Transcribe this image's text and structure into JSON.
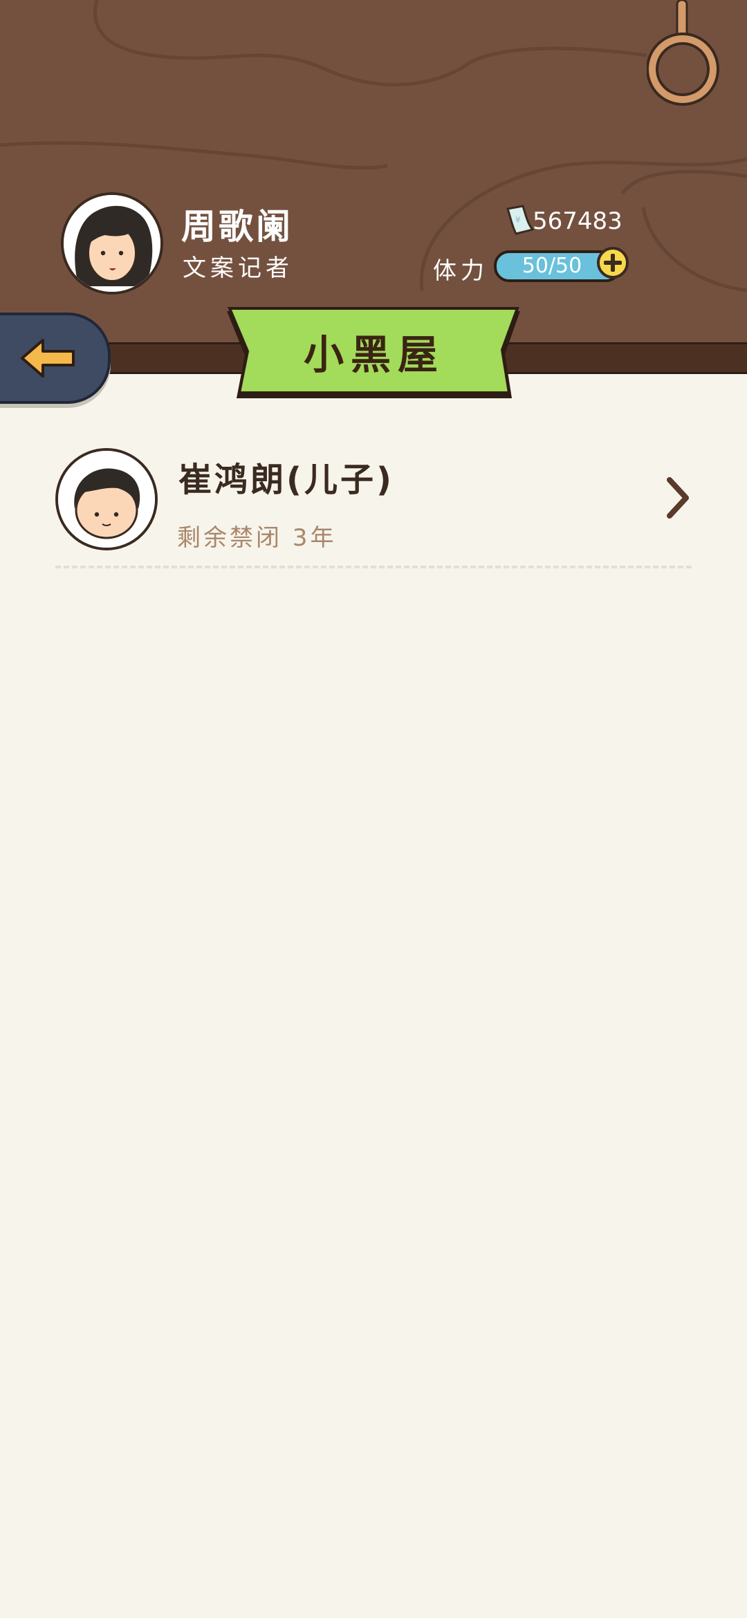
{
  "player": {
    "name": "周歌阑",
    "title": "文案记者",
    "money": "567483",
    "stamina_label": "体力",
    "stamina_value": "50/50"
  },
  "page": {
    "title": "小黑屋"
  },
  "list": [
    {
      "name": "崔鸿朗(儿子)",
      "status": "剩余禁闭 3年"
    }
  ],
  "icons": {
    "back": "arrow-left-icon",
    "money": "banknote-icon",
    "add": "plus-icon",
    "more": "chevron-right-icon",
    "rope": "rope-ring-icon"
  },
  "colors": {
    "header": "#74513f",
    "banner": "#a3db5a",
    "stamina": "#69c1dc",
    "add_button": "#f7d84a",
    "back_button": "#3e4b63",
    "background": "#f7f4ec"
  }
}
